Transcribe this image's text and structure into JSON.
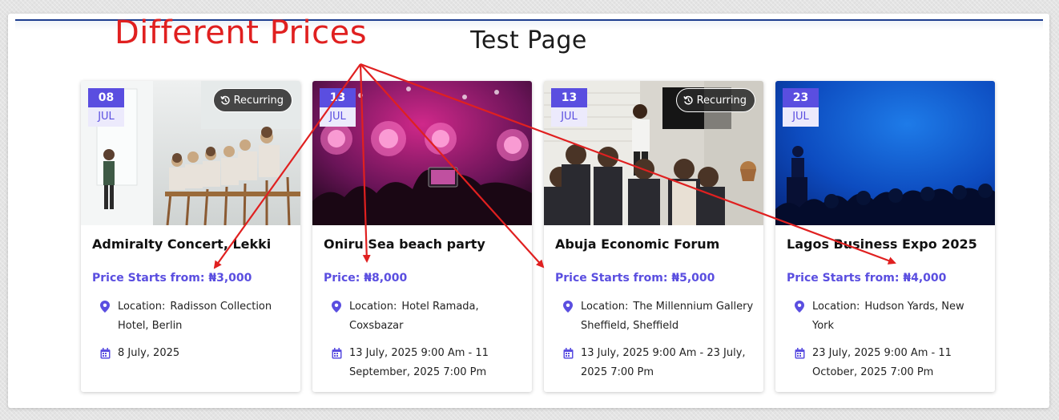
{
  "page": {
    "title": "Test Page"
  },
  "annotation": {
    "label": "Different Prices",
    "color": "#e02020"
  },
  "colors": {
    "accent": "#5a4ee0",
    "annotation": "#e02020",
    "topline": "#1d3d8f"
  },
  "location_label": "Location:",
  "cards": [
    {
      "day": "08",
      "month": "JUL",
      "recurring": "Recurring",
      "title": "Admiralty Concert, Lekki",
      "price": "Price Starts from: ₦3,000",
      "location": "Radisson Collection Hotel, Berlin",
      "date": "8 July, 2025",
      "image": "conference-room-photo"
    },
    {
      "day": "13",
      "month": "JUL",
      "recurring": "",
      "title": "Oniru Sea beach party",
      "price": "Price: ₦8,000",
      "location": "Hotel Ramada, Coxsbazar",
      "date": "13 July, 2025  9:00 Am - 11 September, 2025 7:00 Pm",
      "image": "concert-crowd-photo"
    },
    {
      "day": "13",
      "month": "JUL",
      "recurring": "Recurring",
      "title": "Abuja Economic Forum",
      "price": "Price Starts from: ₦5,000",
      "location": "The Millennium Gallery Sheffield, Sheffield",
      "date": "13 July, 2025  9:00 Am - 23 July, 2025 7:00 Pm",
      "image": "presentation-photo"
    },
    {
      "day": "23",
      "month": "JUL",
      "recurring": "",
      "title": "Lagos Business Expo 2025",
      "price": "Price Starts from: ₦4,000",
      "location": "Hudson Yards, New York",
      "date": "23 July, 2025  9:00 Am - 11 October, 2025 7:00 Pm",
      "image": "keynote-audience-photo"
    }
  ],
  "icons": [
    "cursor-icon",
    "recurring-icon",
    "location-pin-icon",
    "calendar-icon"
  ]
}
